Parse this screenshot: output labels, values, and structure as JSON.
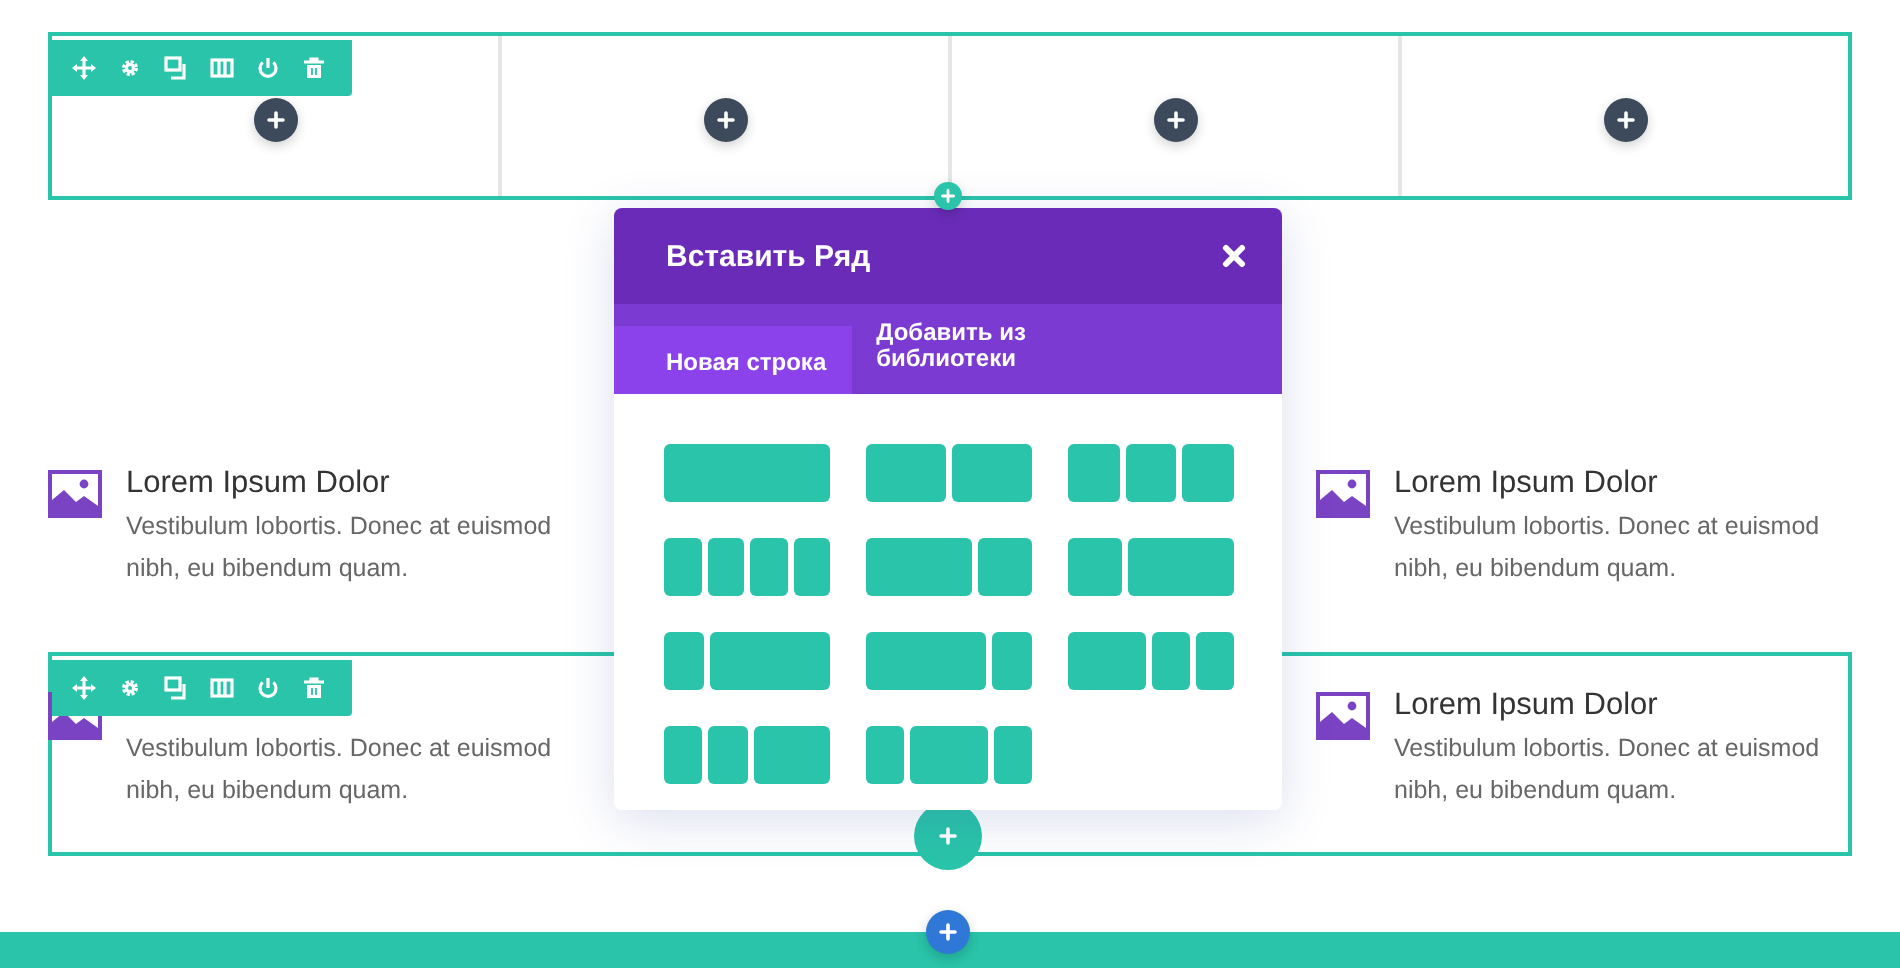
{
  "top_row": {
    "toolbar": true,
    "columns": [
      {
        "kind": "empty"
      },
      {
        "kind": "empty"
      },
      {
        "kind": "empty"
      },
      {
        "kind": "empty"
      }
    ]
  },
  "module_rows": [
    {
      "toolbar": false,
      "bordered": false,
      "left": {
        "title": "Lorem Ipsum Dolor",
        "text": "Vestibulum lobortis. Donec at euismod nibh, eu bibendum quam."
      },
      "right": {
        "title": "Lorem Ipsum Dolor",
        "text": "Vestibulum lobortis. Donec at euismod nibh, eu bibendum quam."
      }
    },
    {
      "toolbar": true,
      "bordered": true,
      "left": {
        "text": "Vestibulum lobortis. Donec at euismod nibh, eu bibendum quam."
      },
      "right": {
        "title": "Lorem Ipsum Dolor",
        "text": "Vestibulum lobortis. Donec at euismod nibh, eu bibendum quam."
      }
    }
  ],
  "popup": {
    "title": "Вставить Ряд",
    "tabs": [
      {
        "label": "Новая строка",
        "selected": true
      },
      {
        "label": "Добавить из библиотеки",
        "selected": false
      }
    ],
    "layouts": [
      {
        "kind": "full"
      },
      {
        "kind": "halves"
      },
      {
        "kind": "thirds"
      },
      {
        "kind": "quarters"
      },
      {
        "kind": "wide-narrow"
      },
      {
        "kind": "narrow-wide"
      },
      {
        "kind": "quarter-threequarters"
      },
      {
        "kind": "threequarters-quarter"
      },
      {
        "kind": "half-quarter-quarter"
      },
      {
        "kind": "quarter-quarter-half"
      },
      {
        "kind": "quarter-half-quarter"
      }
    ]
  }
}
